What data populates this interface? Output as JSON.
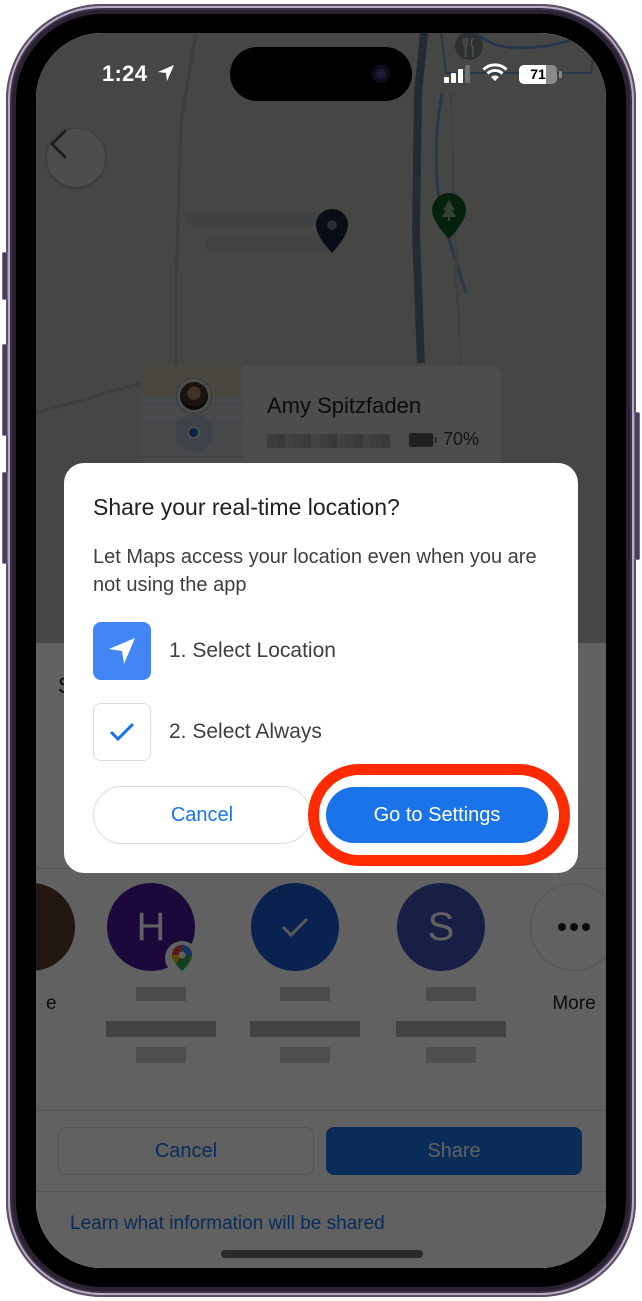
{
  "status_bar": {
    "time": "1:24",
    "battery_level": "71",
    "battery_fraction": 0.71,
    "icons": [
      "location-arrow-icon",
      "cellular-signal-icon",
      "wifi-icon",
      "battery-icon"
    ]
  },
  "map": {
    "back_icon": "chevron-left-icon",
    "pins": [
      "place-pin-icon",
      "park-pin-icon",
      "restaurant-pin-icon"
    ]
  },
  "person_card": {
    "name": "Amy Spitzfaden",
    "battery_percent": "70%"
  },
  "sheet": {
    "heading_partial": "S",
    "contacts": [
      {
        "initial": "",
        "label": "e",
        "color": "#5a3b2a",
        "icon": "photo-avatar"
      },
      {
        "initial": "H",
        "label": "",
        "color": "#4a1a9c",
        "icon": "google-maps-badge-icon"
      },
      {
        "initial": "",
        "label": "",
        "color": "#1a5bd0",
        "icon": "checkmark-icon"
      },
      {
        "initial": "S",
        "label": "",
        "color": "#3f51b5",
        "icon": ""
      },
      {
        "initial": "",
        "label": "More",
        "color": "#ffffff",
        "icon": "more-horizontal-icon"
      }
    ],
    "cancel_label": "Cancel",
    "share_label": "Share",
    "learn_link": "Learn what information will be shared"
  },
  "dialog": {
    "title": "Share your real-time location?",
    "body": "Let Maps access your location even when you are not using the app",
    "steps": [
      {
        "label": "1. Select Location",
        "icon": "location-arrow-icon"
      },
      {
        "label": "2. Select Always",
        "icon": "checkmark-icon"
      }
    ],
    "cancel_label": "Cancel",
    "settings_label": "Go to Settings"
  },
  "colors": {
    "accent": "#1a73e8",
    "step_icon_blue": "#4285f4",
    "highlight": "#ff2a00",
    "frame": "#2a2233"
  }
}
